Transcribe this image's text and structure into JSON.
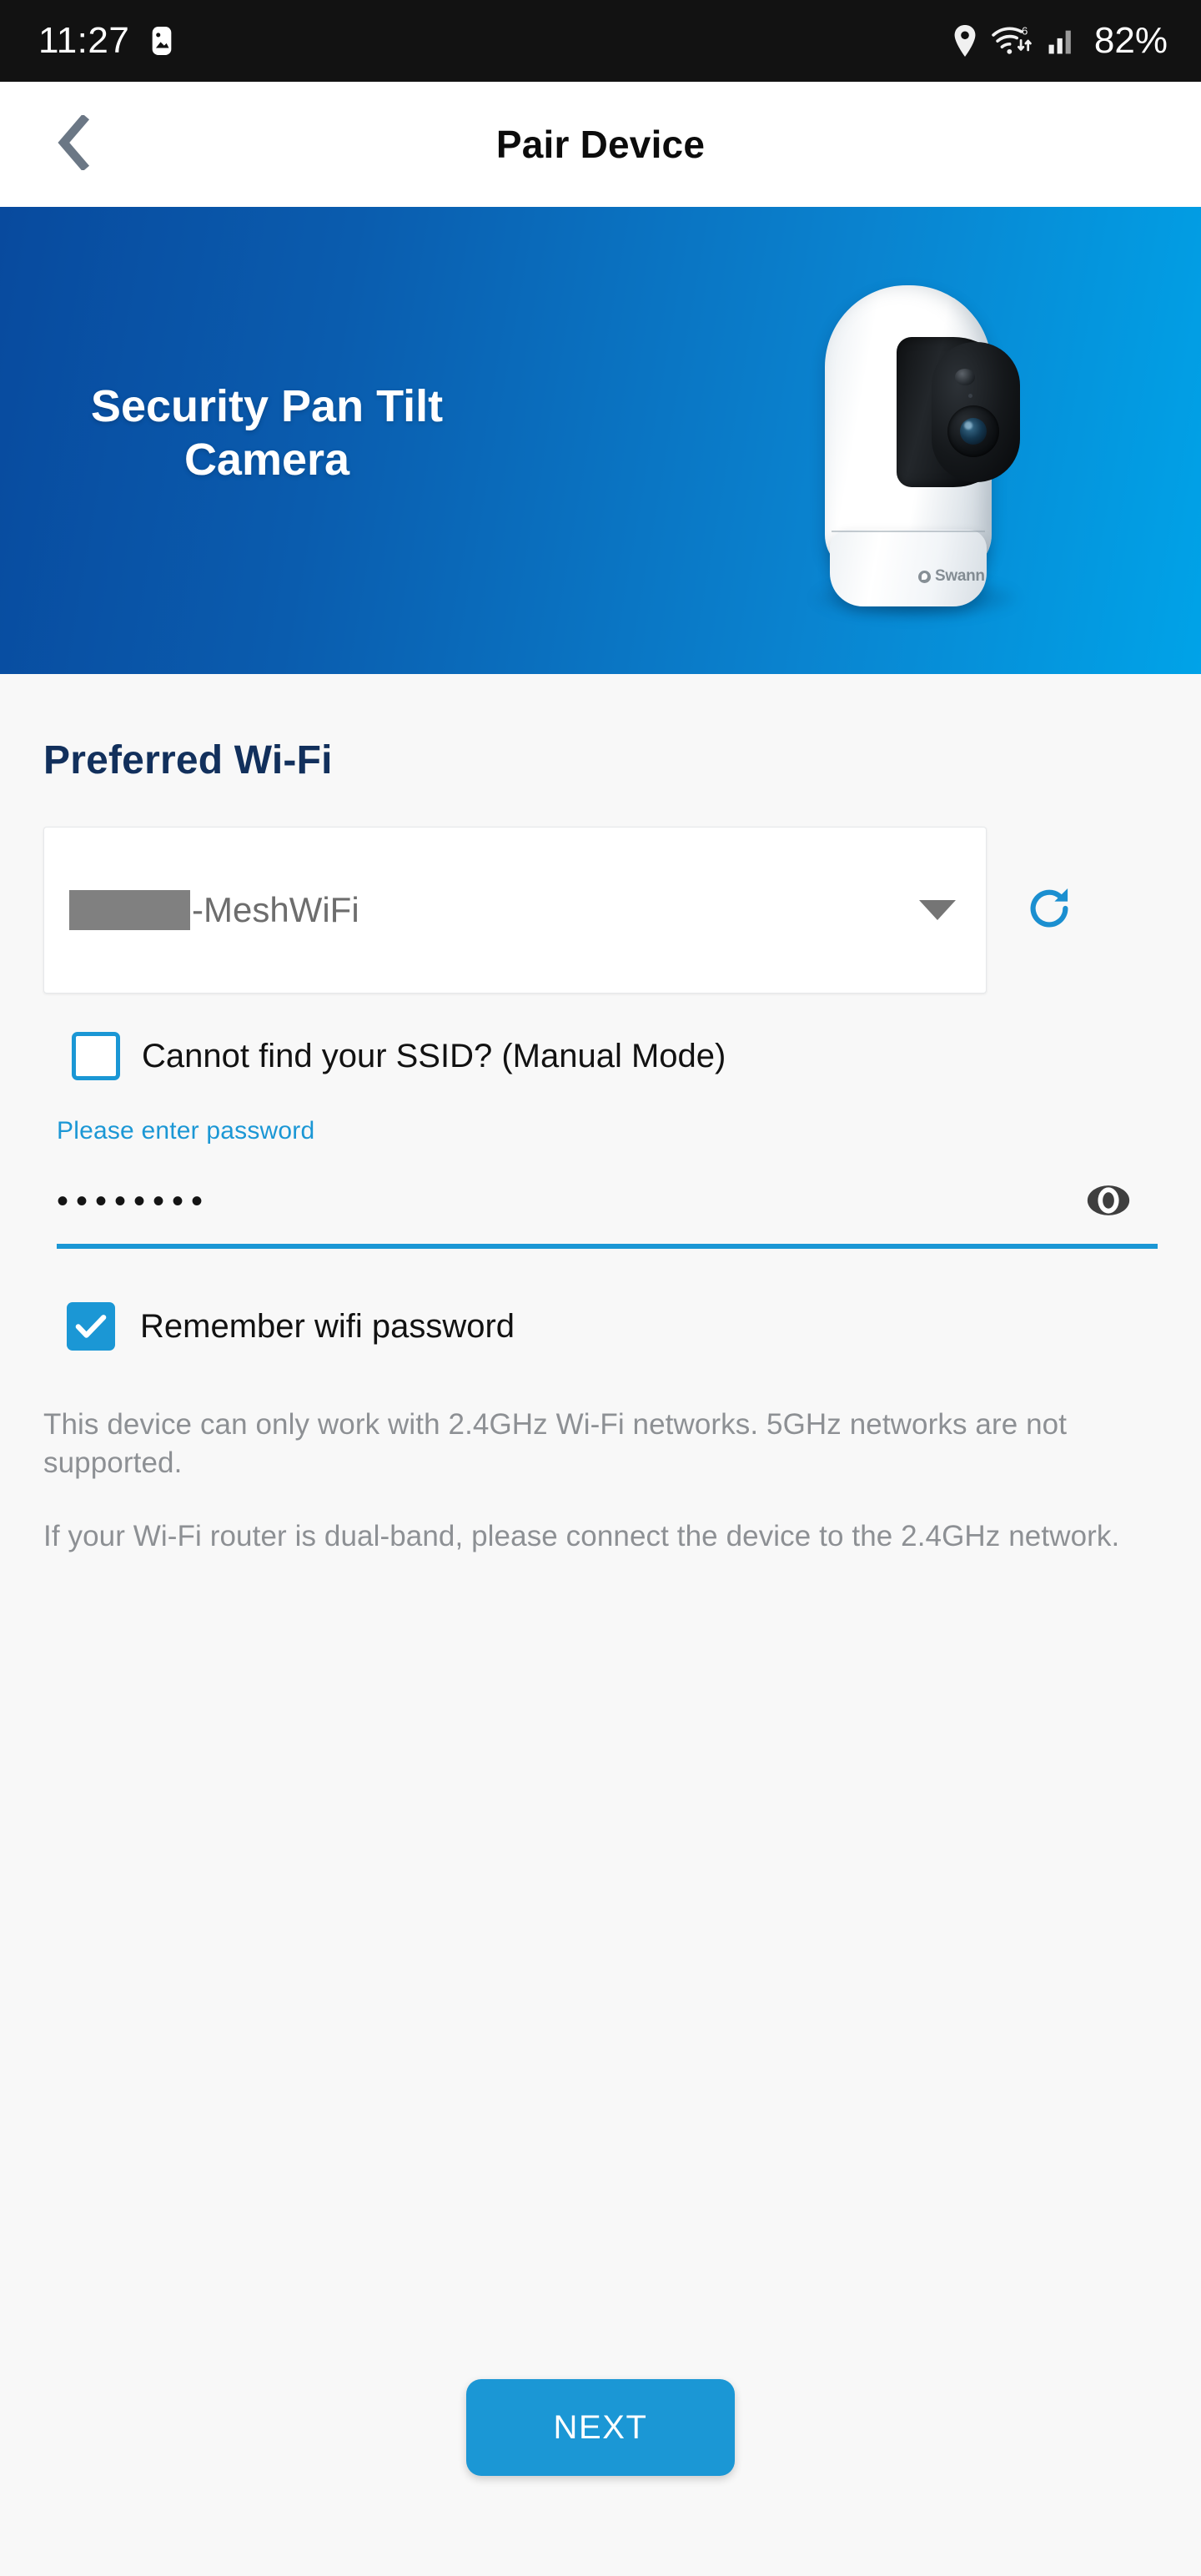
{
  "status_bar": {
    "time": "11:27",
    "battery": "82%",
    "icons": [
      "image-icon",
      "location-pin-icon",
      "wifi-6-icon",
      "cellular-signal-icon"
    ]
  },
  "app_bar": {
    "title": "Pair Device",
    "back_icon": "chevron-left-icon"
  },
  "hero": {
    "title_line1": "Security Pan Tilt",
    "title_line2": "Camera",
    "device_brand": "Swann",
    "gradient_from": "#084a9e",
    "gradient_to": "#00a3e8"
  },
  "wifi": {
    "section_title": "Preferred Wi-Fi",
    "ssid_redacted": true,
    "ssid_suffix": "-MeshWiFi",
    "dropdown_icon": "chevron-down-icon",
    "refresh_icon": "refresh-icon",
    "manual_mode_label": "Cannot find your SSID? (Manual Mode)",
    "manual_mode_checked": false,
    "password_label": "Please enter password",
    "password_value": "••••••••",
    "password_visibility_icon": "eye-icon",
    "remember_label": "Remember wifi password",
    "remember_checked": true
  },
  "notes": [
    "This device can only work with 2.4GHz Wi-Fi networks. 5GHz networks are not supported.",
    "If your Wi-Fi router is dual-band, please connect the device to the 2.4GHz network."
  ],
  "footer": {
    "next_label": "NEXT",
    "accent_color": "#1b97d5"
  }
}
